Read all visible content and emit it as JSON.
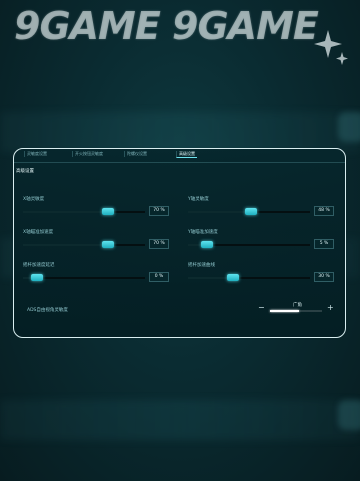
{
  "watermark": {
    "text": "9GAME 9GAME"
  },
  "icons": {
    "sparkle": "sparkle-icon",
    "minus": "minus-icon",
    "plus": "plus-icon"
  },
  "colors": {
    "accent": "#5fe3ee",
    "panel_border": "#d9eef0",
    "background": "#0a2b31"
  },
  "tabs": [
    {
      "label": "灵敏度设置",
      "active": false
    },
    {
      "label": "开火按钮灵敏度",
      "active": false
    },
    {
      "label": "陀螺仪设置",
      "active": false
    },
    {
      "label": "高级设置",
      "active": true
    }
  ],
  "section_title": "高级设置",
  "settings": [
    {
      "label": "X轴灵敏度",
      "value_text": "70 %",
      "level": 0.7
    },
    {
      "label": "Y轴灵敏度",
      "value_text": "48 %",
      "level": 0.48
    },
    {
      "label": "X轴瞄准加速度",
      "value_text": "70 %",
      "level": 0.7
    },
    {
      "label": "Y轴瞄准加速度",
      "value_text": "5 %",
      "level": 0.05
    },
    {
      "label": "摇杆加速度延迟",
      "value_text": "0 %",
      "level": 0.0
    },
    {
      "label": "摇杆加速曲线",
      "value_text": "30 %",
      "level": 0.3
    }
  ],
  "bottom": {
    "label": "ADS自由视角灵敏度",
    "level_label": "广角",
    "level": 0.55
  }
}
